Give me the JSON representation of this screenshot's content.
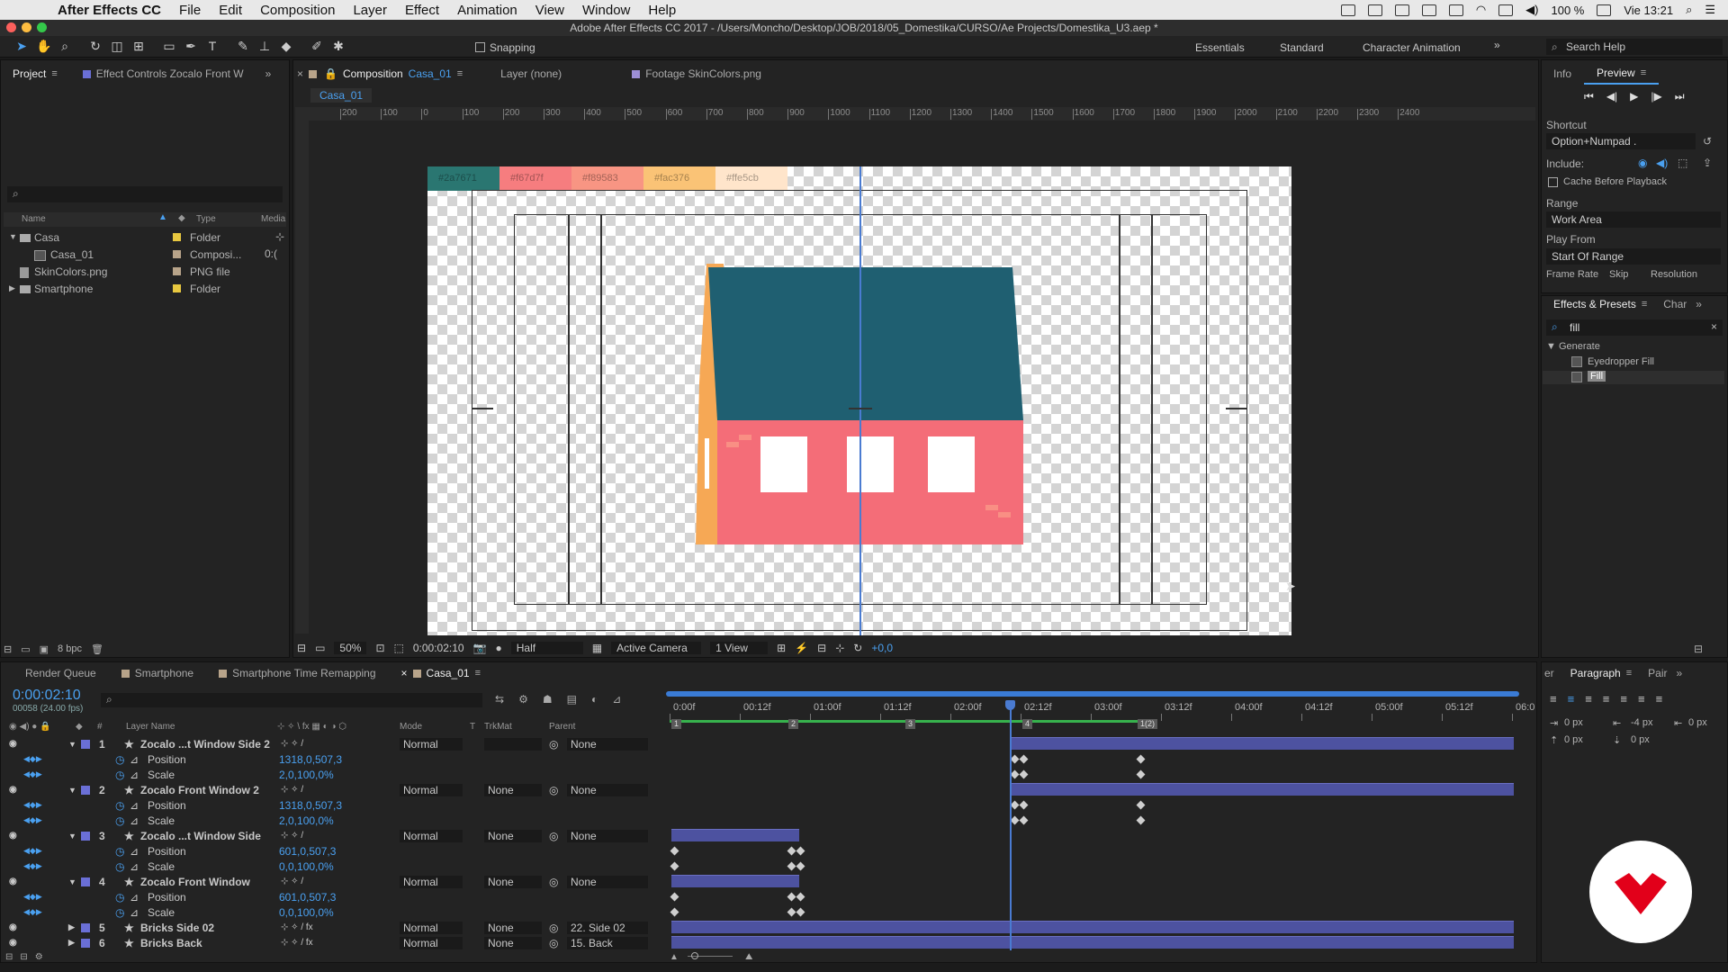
{
  "menubar": {
    "app": "After Effects CC",
    "items": [
      "File",
      "Edit",
      "Composition",
      "Layer",
      "Effect",
      "Animation",
      "View",
      "Window",
      "Help"
    ],
    "battery": "100 %",
    "clock": "Vie 13:21"
  },
  "window_title": "Adobe After Effects CC 2017 - /Users/Moncho/Desktop/JOB/2018/05_Domestika/CURSO/Ae Projects/Domestika_U3.aep *",
  "toolbar": {
    "snapping": "Snapping",
    "workspaces": [
      "Essentials",
      "Standard",
      "Character Animation"
    ],
    "search_help": "Search Help"
  },
  "project_panel": {
    "tab_project": "Project",
    "tab_effect_controls": "Effect Controls Zocalo Front W",
    "columns": {
      "name": "Name",
      "type": "Type",
      "media": "Media"
    },
    "items": [
      {
        "name": "Casa",
        "type": "Folder",
        "media": "",
        "color": "#e8c840",
        "icon": "folder-icon"
      },
      {
        "name": "Casa_01",
        "type": "Composi...",
        "media": "0:(",
        "color": "#b8a48a",
        "icon": "composition-icon"
      },
      {
        "name": "SkinColors.png",
        "type": "PNG file",
        "media": "",
        "color": "#b8a48a",
        "icon": "image-file-icon"
      },
      {
        "name": "Smartphone",
        "type": "Folder",
        "media": "",
        "color": "#e8c840",
        "icon": "folder-icon"
      }
    ],
    "bpc": "8 bpc"
  },
  "comp_panel": {
    "tab_comp_prefix": "Composition",
    "tab_comp_name": "Casa_01",
    "tab_layer": "Layer (none)",
    "tab_footage": "Footage SkinColors.png",
    "breadcrumb": "Casa_01",
    "ruler_labels": [
      "200",
      "100",
      "0",
      "100",
      "200",
      "300",
      "400",
      "500",
      "600",
      "700",
      "800",
      "900",
      "1000",
      "1100",
      "1200",
      "1300",
      "1400",
      "1500",
      "1600",
      "1700",
      "1800",
      "1900",
      "2000",
      "2100",
      "2200",
      "2300",
      "2400"
    ],
    "swatches": [
      {
        "label": "#2a7671",
        "color": "#2a7671"
      },
      {
        "label": "#f67d7f",
        "color": "#f67d7f"
      },
      {
        "label": "#f89583",
        "color": "#f89583"
      },
      {
        "label": "#fac376",
        "color": "#fac376"
      },
      {
        "label": "#ffe5cb",
        "color": "#ffe5cb"
      }
    ],
    "colors": {
      "roof": "#1f5f71",
      "wall": "#f46d78",
      "side": "#f6a855",
      "window": "#ffffff",
      "brick": "#f98f84"
    },
    "footer": {
      "zoom": "50%",
      "timecode": "0:00:02:10",
      "resolution": "Half",
      "camera": "Active Camera",
      "views": "1 View",
      "exposure": "+0,0"
    }
  },
  "preview_panel": {
    "tab_info": "Info",
    "tab_preview": "Preview",
    "shortcut_label": "Shortcut",
    "shortcut_value": "Option+Numpad .",
    "include_label": "Include:",
    "cache_label": "Cache Before Playback",
    "range_label": "Range",
    "range_value": "Work Area",
    "play_from_label": "Play From",
    "play_from_value": "Start Of Range",
    "frame_rate": "Frame Rate",
    "skip": "Skip",
    "resolution": "Resolution"
  },
  "effects_panel": {
    "tab": "Effects & Presets",
    "tab2": "Char",
    "search": "fill",
    "category": "Generate",
    "items": [
      "Eyedropper Fill",
      "Fill"
    ]
  },
  "paragraph_panel": {
    "tab_prev": "er",
    "tab": "Paragraph",
    "tab2": "Pair",
    "values": [
      "0 px",
      "-4 px",
      "0 px",
      "0 px",
      "0 px"
    ]
  },
  "timeline": {
    "tabs": [
      "Render Queue",
      "Smartphone",
      "Smartphone Time Remapping",
      "Casa_01"
    ],
    "timecode": "0:00:02:10",
    "frames": "00058 (24.00 fps)",
    "headers": {
      "layer_name": "Layer Name",
      "mode": "Mode",
      "t": "T",
      "trkmat": "TrkMat",
      "parent": "Parent",
      "num": "#"
    },
    "time_labels": [
      "0:00f",
      "00:12f",
      "01:00f",
      "01:12f",
      "02:00f",
      "02:12f",
      "03:00f",
      "03:12f",
      "04:00f",
      "04:12f",
      "05:00f",
      "05:12f",
      "06:0"
    ],
    "markers": [
      "1",
      "2",
      "3",
      "4",
      "1(2)"
    ],
    "rows": [
      {
        "kind": "layer",
        "num": "1",
        "name": "Zocalo ...t Window Side 2",
        "mode": "Normal",
        "trkmat": "",
        "parent": "None"
      },
      {
        "kind": "prop",
        "name": "Position",
        "value": "1318,0,507,3"
      },
      {
        "kind": "prop",
        "name": "Scale",
        "value": "2,0,100,0%"
      },
      {
        "kind": "layer",
        "num": "2",
        "name": "Zocalo Front Window 2",
        "mode": "Normal",
        "trkmat": "None",
        "parent": "None"
      },
      {
        "kind": "prop",
        "name": "Position",
        "value": "1318,0,507,3"
      },
      {
        "kind": "prop",
        "name": "Scale",
        "value": "2,0,100,0%"
      },
      {
        "kind": "layer",
        "num": "3",
        "name": "Zocalo ...t Window Side",
        "mode": "Normal",
        "trkmat": "None",
        "parent": "None"
      },
      {
        "kind": "prop",
        "name": "Position",
        "value": "601,0,507,3"
      },
      {
        "kind": "prop",
        "name": "Scale",
        "value": "0,0,100,0%"
      },
      {
        "kind": "layer",
        "num": "4",
        "name": "Zocalo Front Window",
        "mode": "Normal",
        "trkmat": "None",
        "parent": "None"
      },
      {
        "kind": "prop",
        "name": "Position",
        "value": "601,0,507,3"
      },
      {
        "kind": "prop",
        "name": "Scale",
        "value": "0,0,100,0%"
      },
      {
        "kind": "layer",
        "num": "5",
        "name": "Bricks Side 02",
        "mode": "Normal",
        "trkmat": "None",
        "parent": "22. Side 02"
      },
      {
        "kind": "layer",
        "num": "6",
        "name": "Bricks Back",
        "mode": "Normal",
        "trkmat": "None",
        "parent": "15. Back"
      }
    ]
  }
}
